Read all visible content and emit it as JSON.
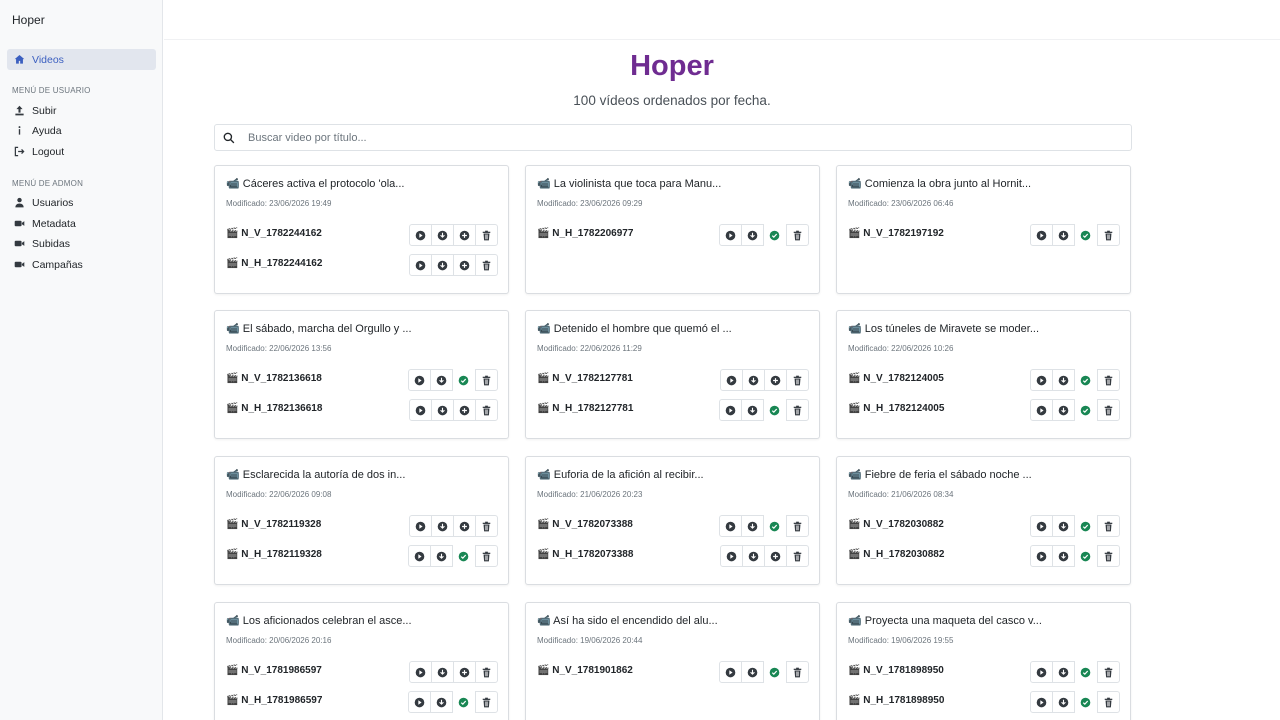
{
  "app": {
    "brand": "Hoper"
  },
  "sidebar": {
    "main_items": [
      {
        "label": "Videos",
        "icon": "home-icon",
        "active": true
      }
    ],
    "user_section_label": "MENÚ DE USUARIO",
    "user_items": [
      {
        "label": "Subir",
        "icon": "upload-icon"
      },
      {
        "label": "Ayuda",
        "icon": "info-icon"
      },
      {
        "label": "Logout",
        "icon": "logout-icon"
      }
    ],
    "admin_section_label": "MENÚ DE ADMON",
    "admin_items": [
      {
        "label": "Usuarios",
        "icon": "user-icon"
      },
      {
        "label": "Metadata",
        "icon": "video-camera-icon"
      },
      {
        "label": "Subidas",
        "icon": "video-camera-icon"
      },
      {
        "label": "Campañas",
        "icon": "video-camera-icon"
      }
    ]
  },
  "main": {
    "title": "Hoper",
    "subtitle": "100 vídeos ordenados por fecha.",
    "search_placeholder": "Buscar video por título..."
  },
  "colors": {
    "title": "#6f2c91",
    "active_nav": "#3b5fc0",
    "success": "#198754",
    "icon": "#343a40"
  },
  "cards": [
    {
      "title": "📹 Cáceres activa el protocolo 'ola...",
      "date": "Modificado: 23/06/2026 19:49",
      "files": [
        {
          "name": "🎬 N_V_1782244162",
          "status": "plus"
        },
        {
          "name": "🎬 N_H_1782244162",
          "status": "plus"
        }
      ]
    },
    {
      "title": "📹 La violinista que toca para Manu...",
      "date": "Modificado: 23/06/2026 09:29",
      "files": [
        {
          "name": "🎬 N_H_1782206977",
          "status": "check"
        }
      ]
    },
    {
      "title": "📹 Comienza la obra junto al Hornit...",
      "date": "Modificado: 23/06/2026 06:46",
      "files": [
        {
          "name": "🎬 N_V_1782197192",
          "status": "check"
        }
      ]
    },
    {
      "title": "📹 El sábado, marcha del Orgullo y ...",
      "date": "Modificado: 22/06/2026 13:56",
      "files": [
        {
          "name": "🎬 N_V_1782136618",
          "status": "check"
        },
        {
          "name": "🎬 N_H_1782136618",
          "status": "plus"
        }
      ]
    },
    {
      "title": "📹 Detenido el hombre que quemó el ...",
      "date": "Modificado: 22/06/2026 11:29",
      "files": [
        {
          "name": "🎬 N_V_1782127781",
          "status": "plus"
        },
        {
          "name": "🎬 N_H_1782127781",
          "status": "check"
        }
      ]
    },
    {
      "title": "📹 Los túneles de Miravete se moder...",
      "date": "Modificado: 22/06/2026 10:26",
      "files": [
        {
          "name": "🎬 N_V_1782124005",
          "status": "check"
        },
        {
          "name": "🎬 N_H_1782124005",
          "status": "check"
        }
      ]
    },
    {
      "title": "📹 Esclarecida la autoría de dos in...",
      "date": "Modificado: 22/06/2026 09:08",
      "files": [
        {
          "name": "🎬 N_V_1782119328",
          "status": "plus"
        },
        {
          "name": "🎬 N_H_1782119328",
          "status": "check"
        }
      ]
    },
    {
      "title": "📹 Euforia de la afición al recibir...",
      "date": "Modificado: 21/06/2026 20:23",
      "files": [
        {
          "name": "🎬 N_V_1782073388",
          "status": "check"
        },
        {
          "name": "🎬 N_H_1782073388",
          "status": "plus"
        }
      ]
    },
    {
      "title": "📹 Fiebre de feria el sábado noche ...",
      "date": "Modificado: 21/06/2026 08:34",
      "files": [
        {
          "name": "🎬 N_V_1782030882",
          "status": "check"
        },
        {
          "name": "🎬 N_H_1782030882",
          "status": "check"
        }
      ]
    },
    {
      "title": "📹 Los aficionados celebran el asce...",
      "date": "Modificado: 20/06/2026 20:16",
      "files": [
        {
          "name": "🎬 N_V_1781986597",
          "status": "plus"
        },
        {
          "name": "🎬 N_H_1781986597",
          "status": "check"
        }
      ]
    },
    {
      "title": "📹 Así ha sido el encendido del alu...",
      "date": "Modificado: 19/06/2026 20:44",
      "files": [
        {
          "name": "🎬 N_V_1781901862",
          "status": "check"
        }
      ]
    },
    {
      "title": "📹 Proyecta una maqueta del casco v...",
      "date": "Modificado: 19/06/2026 19:55",
      "files": [
        {
          "name": "🎬 N_V_1781898950",
          "status": "check"
        },
        {
          "name": "🎬 N_H_1781898950",
          "status": "check"
        }
      ]
    }
  ]
}
